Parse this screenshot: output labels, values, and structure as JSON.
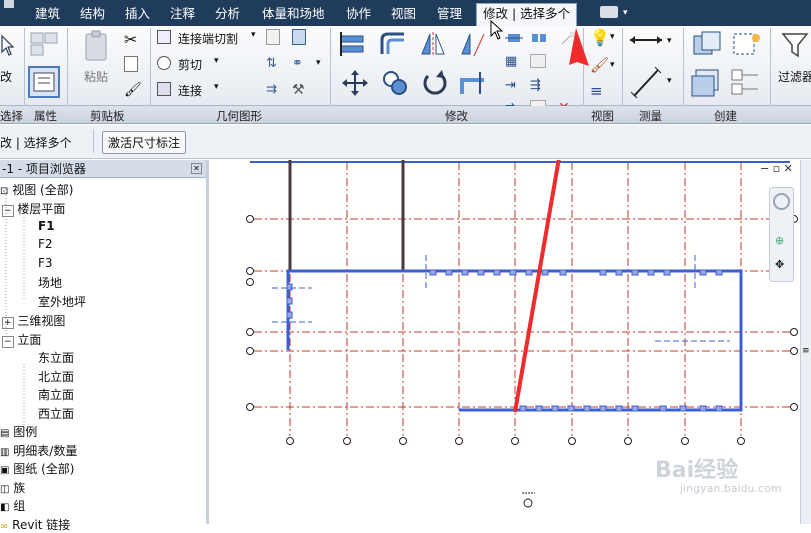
{
  "tabs": [
    "建筑",
    "结构",
    "插入",
    "注释",
    "分析",
    "体量和场地",
    "协作",
    "视图",
    "管理",
    "修改 | 选择多个"
  ],
  "ribbon": {
    "left_btn": "改",
    "paste_label": "粘贴",
    "cut_join_label": "连接端切割",
    "cut_label": "剪切",
    "join_label": "连接",
    "filter_label": "过滤器",
    "groups": [
      "选择",
      "属性",
      "剪贴板",
      "几何图形",
      "修改",
      "视图",
      "测量",
      "创建"
    ]
  },
  "options_bar": {
    "context": "改 | 选择多个",
    "activate_dim": "激活尺寸标注"
  },
  "project_browser": {
    "title": "-1 - 项目浏览器",
    "items": [
      {
        "label": "视图 (全部)"
      },
      {
        "label": "楼层平面"
      },
      {
        "label": "F1"
      },
      {
        "label": "F2"
      },
      {
        "label": "F3"
      },
      {
        "label": "场地"
      },
      {
        "label": "室外地坪"
      },
      {
        "label": "三维视图"
      },
      {
        "label": "立面"
      },
      {
        "label": "东立面"
      },
      {
        "label": "北立面"
      },
      {
        "label": "南立面"
      },
      {
        "label": "西立面"
      },
      {
        "label": "图例"
      },
      {
        "label": "明细表/数量"
      },
      {
        "label": "图纸 (全部)"
      },
      {
        "label": "族"
      },
      {
        "label": "组"
      },
      {
        "label": "Revit 链接"
      }
    ]
  },
  "watermark": {
    "brand": "Bai经验",
    "url": "jingyan.baidu.com"
  },
  "colors": {
    "tab_bar": "#1f3c5c",
    "arrow_red": "#ef2b2b",
    "grid_red": "#c0392b",
    "wall_blue": "#3d5fd6"
  }
}
